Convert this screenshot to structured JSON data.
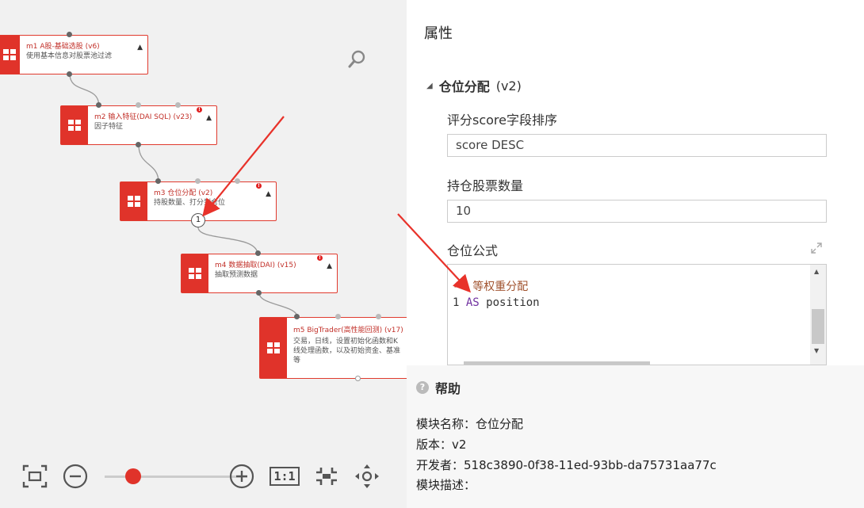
{
  "canvas": {
    "nodes": [
      {
        "title": "m1 A股-基础选股 (v6)",
        "desc": "使用基本信息对股票池过滤"
      },
      {
        "title": "m2 输入特征(DAI SQL) (v23)",
        "desc": "因子特征"
      },
      {
        "title": "m3 仓位分配 (v2)",
        "desc": "持股数量、打分到仓位"
      },
      {
        "title": "m4 数据抽取(DAI) (v15)",
        "desc": "抽取预测数据"
      },
      {
        "title": "m5 BigTrader(高性能回测) (v17)",
        "desc": "交易，日线，设置初始化函数和K线处理函数，以及初始资金、基准等"
      }
    ],
    "badge": "1",
    "toolbar": {
      "one_to_one": "1:1",
      "zoom_level": 0.2
    }
  },
  "panel": {
    "title": "属性",
    "section": {
      "name": "仓位分配",
      "version": "(v2)"
    },
    "fields": {
      "score_label": "评分score字段排序",
      "score_value": "score DESC",
      "count_label": "持仓股票数量",
      "count_value": "10",
      "formula_label": "仓位公式"
    },
    "code": {
      "line1_comment": "-- 等权重分配",
      "line2_num": "1",
      "line2_kw": "AS",
      "line2_rest": "position"
    }
  },
  "help": {
    "title": "帮助",
    "module_name": "模块名称：仓位分配",
    "version": "版本：v2",
    "developer": "开发者：518c3890-0f38-11ed-93bb-da75731aa77c",
    "description": "模块描述："
  },
  "colors": {
    "accent": "#e0332a",
    "arrow": "#e8322a"
  }
}
